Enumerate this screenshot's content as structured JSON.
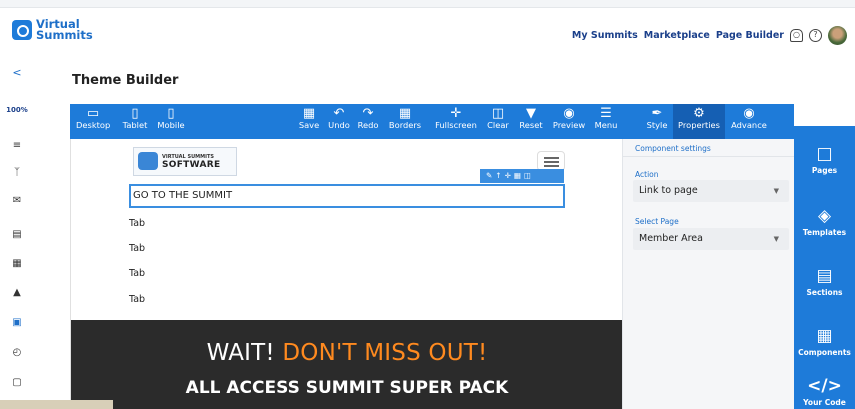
{
  "brand": {
    "line1": "Virtual",
    "line2": "Summits"
  },
  "topnav": {
    "my_summits": "My Summits",
    "marketplace": "Marketplace",
    "page_builder": "Page Builder"
  },
  "sidebar": {
    "collapse": "<",
    "zoom": "100%"
  },
  "page": {
    "title": "Theme Builder"
  },
  "toolbar": {
    "devices": [
      {
        "label": "Desktop",
        "icon": "desktop-icon"
      },
      {
        "label": "Tablet",
        "icon": "tablet-icon"
      },
      {
        "label": "Mobile",
        "icon": "mobile-icon"
      }
    ],
    "actions": [
      {
        "label": "Save",
        "icon": "save-icon"
      },
      {
        "label": "Undo",
        "icon": "undo-icon"
      },
      {
        "label": "Redo",
        "icon": "redo-icon"
      },
      {
        "label": "Borders",
        "icon": "borders-icon"
      },
      {
        "label": "Fullscreen",
        "icon": "fullscreen-icon"
      },
      {
        "label": "Clear",
        "icon": "trash-icon"
      },
      {
        "label": "Reset",
        "icon": "reset-icon"
      },
      {
        "label": "Preview",
        "icon": "eye-icon"
      },
      {
        "label": "Menu",
        "icon": "menu-icon"
      }
    ],
    "modes": [
      {
        "label": "Style",
        "icon": "brush-icon"
      },
      {
        "label": "Properties",
        "icon": "gears-icon"
      },
      {
        "label": "Advance",
        "icon": "palette-icon"
      }
    ]
  },
  "canvas": {
    "logo_line1": "VIRTUAL SUMMITS",
    "logo_line2": "SOFTWARE",
    "selected_text": "GO TO THE SUMMIT",
    "tabs": [
      "Tab",
      "Tab",
      "Tab",
      "Tab"
    ],
    "banner": {
      "wait": "WAIT! ",
      "dont_miss": "DON'T MISS OUT!",
      "pack": "ALL ACCESS SUMMIT SUPER PACK"
    }
  },
  "panel": {
    "header": "Component settings",
    "action_label": "Action",
    "action_value": "Link to page",
    "page_label": "Select Page",
    "page_value": "Member Area"
  },
  "rightbar": [
    {
      "label": "Pages",
      "icon": "page-icon"
    },
    {
      "label": "Templates",
      "icon": "fill-icon"
    },
    {
      "label": "Sections",
      "icon": "sections-icon"
    },
    {
      "label": "Components",
      "icon": "components-icon"
    },
    {
      "label": "Your Code",
      "icon": "code-icon"
    }
  ],
  "colors": {
    "accent": "#1e7bd9",
    "active": "#155fb3",
    "banner_bg": "#2b2b2b",
    "highlight": "#ff8a1f"
  }
}
